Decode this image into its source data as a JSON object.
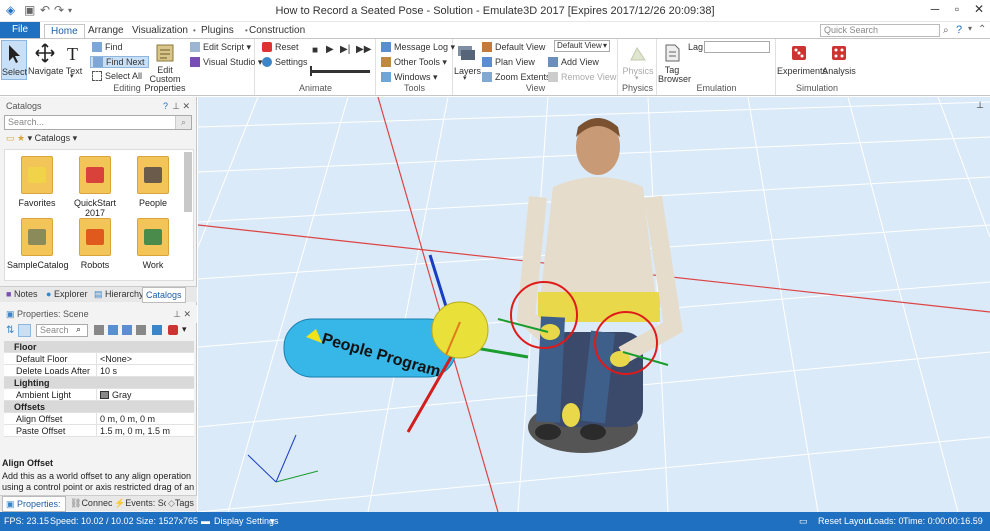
{
  "window": {
    "title": "How to Record a Seated Pose - Solution - Emulate3D 2017 [Expires 2017/12/26 20:09:38]"
  },
  "ribbon_tabs": [
    "File",
    "Home",
    "Arrange",
    "Visualization",
    "Plugins",
    "Construction"
  ],
  "quick_search_placeholder": "Quick Search",
  "ribbon": {
    "editing": {
      "label": "Editing",
      "select": "Select",
      "navigate": "Navigate",
      "text": "Text",
      "find": "Find",
      "find_next": "Find Next",
      "select_all": "Select All",
      "edit_custom_properties": "Edit Custom Properties",
      "edit_script": "Edit Script",
      "visual_studio": "Visual Studio"
    },
    "animate": {
      "label": "Animate",
      "reset": "Reset",
      "settings": "Settings"
    },
    "tools": {
      "label": "Tools",
      "message_log": "Message Log",
      "other_tools": "Other Tools",
      "windows": "Windows"
    },
    "view": {
      "label": "View",
      "layers": "Layers",
      "default_view": "Default View",
      "plan_view": "Plan View",
      "zoom_extents": "Zoom Extents",
      "view_select": "Default View",
      "add_view": "Add View",
      "remove_view": "Remove View"
    },
    "physics": {
      "label": "Physics",
      "physics": "Physics"
    },
    "emulation": {
      "label": "Emulation",
      "tag_browser": "Tag Browser",
      "lag": "Lag"
    },
    "simulation": {
      "label": "Simulation",
      "experiments": "Experiments",
      "analysis": "Analysis"
    }
  },
  "catalogs": {
    "title": "Catalogs",
    "search_placeholder": "Search...",
    "breadcrumb": "Catalogs",
    "items": [
      {
        "label": "Favorites"
      },
      {
        "label": "QuickStart 2017"
      },
      {
        "label": "People"
      },
      {
        "label": "SampleCatalog"
      },
      {
        "label": "Robots"
      },
      {
        "label": "Work"
      }
    ]
  },
  "panel_tabs": [
    "Notes",
    "Explorer",
    "Hierarchy",
    "Catalogs"
  ],
  "properties": {
    "title": "Properties: Scene",
    "search_placeholder": "Search",
    "rows": [
      {
        "type": "category",
        "key": "Floor"
      },
      {
        "type": "prop",
        "key": "Default Floor",
        "value": "<None>"
      },
      {
        "type": "prop",
        "key": "Delete Loads After",
        "value": "10 s"
      },
      {
        "type": "category",
        "key": "Lighting"
      },
      {
        "type": "prop",
        "key": "Ambient Light",
        "value": "Gray"
      },
      {
        "type": "category",
        "key": "Offsets"
      },
      {
        "type": "prop",
        "key": "Align Offset",
        "value": "0 m, 0 m, 0 m"
      },
      {
        "type": "prop",
        "key": "Paste Offset",
        "value": "1.5 m, 0 m, 1.5 m"
      }
    ],
    "desc_title": "Align Offset",
    "desc_text": "Add this as a world offset to any align operation using a control point or axis restricted drag of an o..."
  },
  "bottom_tabs": [
    "Properties: Sce",
    "Connecto",
    "Events: Sce",
    "Tags"
  ],
  "viewport": {
    "label_text": "People Program"
  },
  "statusbar": {
    "fps": "FPS: 23.15",
    "speed": "Speed: 10.02 / 10.02",
    "size": "Size: 1527x765",
    "display": "Display Settings",
    "reset_layout": "Reset Layout",
    "loads": "Loads: 0",
    "time": "Time: 0:00:00:16.59"
  },
  "colors": {
    "accent": "#1f70c1",
    "viewport_bg": "#dbeaf8",
    "highlight": "#f2e21a"
  }
}
